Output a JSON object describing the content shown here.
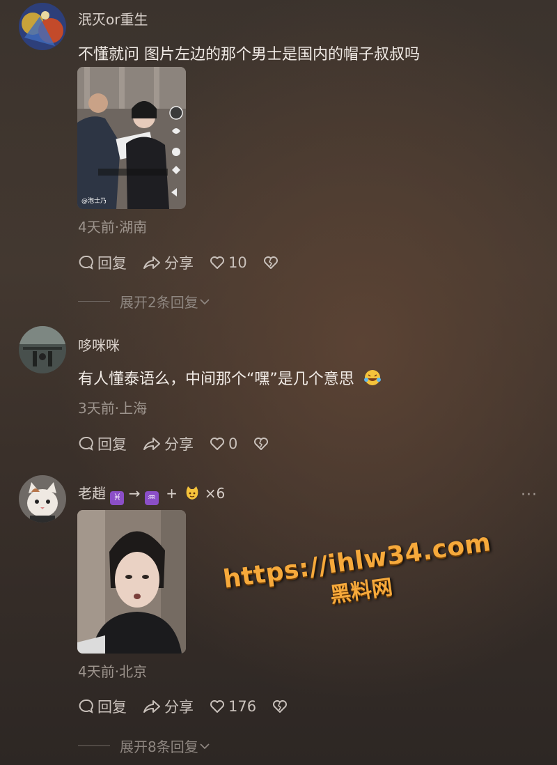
{
  "comments": [
    {
      "username": "泯灭or重生",
      "text": "不懂就问 图片左边的那个男士是国内的帽子叔叔吗",
      "thumb_caption": "@泡士乃",
      "meta": "4天前·湖南",
      "reply_label": "回复",
      "share_label": "分享",
      "likes": "10",
      "expand_label": "展开2条回复"
    },
    {
      "username": "哆咪咪",
      "text": "有人懂泰语么，中间那个“嘿”是几个意思",
      "meta": "3天前·上海",
      "reply_label": "回复",
      "share_label": "分享",
      "likes": "0"
    },
    {
      "username": "老趙",
      "name_suffix": "×6",
      "meta": "4天前·北京",
      "reply_label": "回复",
      "share_label": "分享",
      "likes": "176",
      "expand_label": "展开8条回复",
      "more_label": "···"
    }
  ],
  "watermark": {
    "url": "https://ihlw34.com",
    "name": "黑料网"
  },
  "icons": [
    "comment-bubble-icon",
    "share-arrow-icon",
    "heart-icon",
    "broken-heart-icon",
    "chevron-down-icon",
    "laugh-cry-emoji-icon",
    "pisces-icon",
    "aquarius-icon",
    "cat-face-emoji-icon"
  ],
  "colors": {
    "accent_watermark": "#f6a93b",
    "meta_text": "#9d948d"
  }
}
